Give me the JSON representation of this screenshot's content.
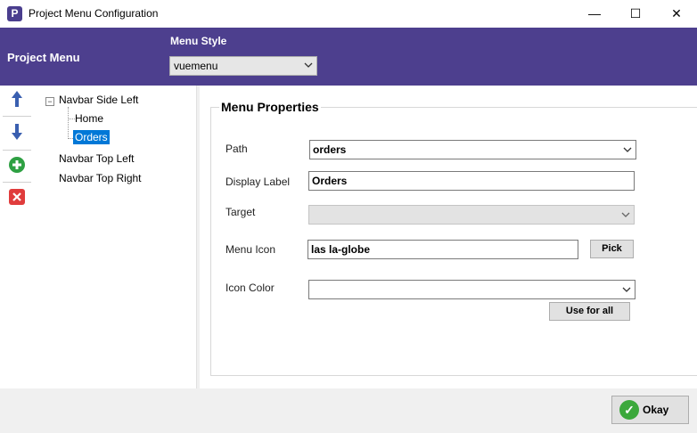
{
  "window": {
    "icon_letter": "P",
    "title": "Project Menu Configuration",
    "minimize": "—",
    "maximize": "☐",
    "close": "✕"
  },
  "header": {
    "title": "Project Menu",
    "menu_style_label": "Menu Style",
    "menu_style_value": "vuemenu"
  },
  "toolbar": {
    "up_icon": "arrow-up-icon",
    "down_icon": "arrow-down-icon",
    "add_icon": "plus-circle-icon",
    "delete_icon": "delete-x-icon"
  },
  "tree": {
    "nodes": [
      {
        "label": "Navbar Side Left"
      },
      {
        "label": "Home"
      },
      {
        "label": "Orders"
      },
      {
        "label": "Navbar Top Left"
      },
      {
        "label": "Navbar Top Right"
      }
    ],
    "selected": "Orders",
    "expander": "−"
  },
  "properties": {
    "title": "Menu Properties",
    "path_label": "Path",
    "path_value": "orders",
    "display_label_label": "Display Label",
    "display_label_value": "Orders",
    "target_label": "Target",
    "target_value": "",
    "menu_icon_label": "Menu Icon",
    "menu_icon_value": "las la-globe",
    "pick_button": "Pick",
    "icon_color_label": "Icon Color",
    "icon_color_value": "",
    "use_for_all_button": "Use for all"
  },
  "footer": {
    "okay_button": "Okay"
  },
  "colors": {
    "header_bg": "#4d3f8e",
    "selection": "#0078d7",
    "arrow_blue": "#3a5fb0",
    "add_green": "#2ea043",
    "delete_red": "#e03c3c"
  }
}
